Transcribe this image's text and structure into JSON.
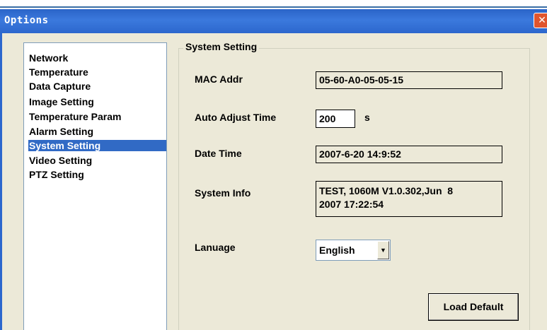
{
  "window": {
    "title": "Options",
    "close_glyph": "✕"
  },
  "nav": {
    "items": [
      {
        "label": "Network"
      },
      {
        "label": "Temperature"
      },
      {
        "label": "Data Capture"
      },
      {
        "label": "Image Setting"
      },
      {
        "label": "Temperature Param"
      },
      {
        "label": "Alarm Setting"
      },
      {
        "label": "System Setting",
        "selected": true
      },
      {
        "label": "Video Setting"
      },
      {
        "label": "PTZ Setting"
      }
    ]
  },
  "system_setting": {
    "group_title": "System Setting",
    "mac_label": "MAC Addr",
    "mac_value": "05-60-A0-05-05-15",
    "auto_adjust_label": "Auto Adjust Time",
    "auto_adjust_value": "200",
    "auto_adjust_unit": "s",
    "date_time_label": "Date Time",
    "date_time_value": "2007-6-20 14:9:52",
    "system_info_label": "System Info",
    "system_info_line1": "TEST, 1060M V1.0.302,Jun  8",
    "system_info_line2": "2007 17:22:54",
    "language_label": "Lanuage",
    "language_value": "English",
    "load_default_label": "Load Default"
  },
  "colors": {
    "title_bar": "#2a64c8",
    "selection": "#316ac5",
    "dialog_bg": "#ece9d8",
    "close_button": "#e0552e"
  }
}
